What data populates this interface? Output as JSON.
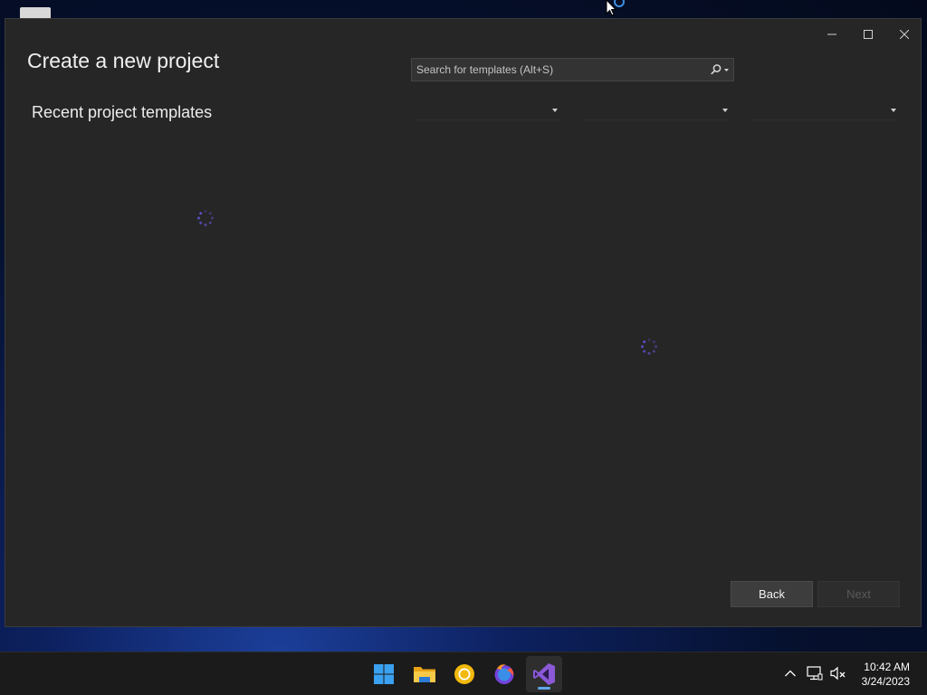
{
  "dialog": {
    "title": "Create a new project",
    "recent_heading": "Recent project templates",
    "search": {
      "placeholder": "Search for templates (Alt+S)",
      "value": ""
    },
    "filters": [
      {
        "selected": ""
      },
      {
        "selected": ""
      },
      {
        "selected": ""
      }
    ],
    "buttons": {
      "back": "Back",
      "next": "Next"
    }
  },
  "window_controls": [
    "minimize-icon",
    "maximize-icon",
    "close-icon"
  ],
  "taskbar": {
    "apps": [
      {
        "name": "start",
        "icon": "windows-logo-icon"
      },
      {
        "name": "file-explorer",
        "icon": "folder-icon"
      },
      {
        "name": "chrome-canary",
        "icon": "chrome-icon"
      },
      {
        "name": "firefox",
        "icon": "firefox-icon"
      },
      {
        "name": "visual-studio",
        "icon": "visual-studio-icon",
        "active": true
      }
    ],
    "tray": [
      "chevron-up-icon",
      "network-icon",
      "volume-muted-icon"
    ],
    "time": "10:42 AM",
    "date": "3/24/2023"
  },
  "colors": {
    "spinner": "#5b50c8",
    "accent": "#60a5e8",
    "window_bg": "#262626"
  }
}
